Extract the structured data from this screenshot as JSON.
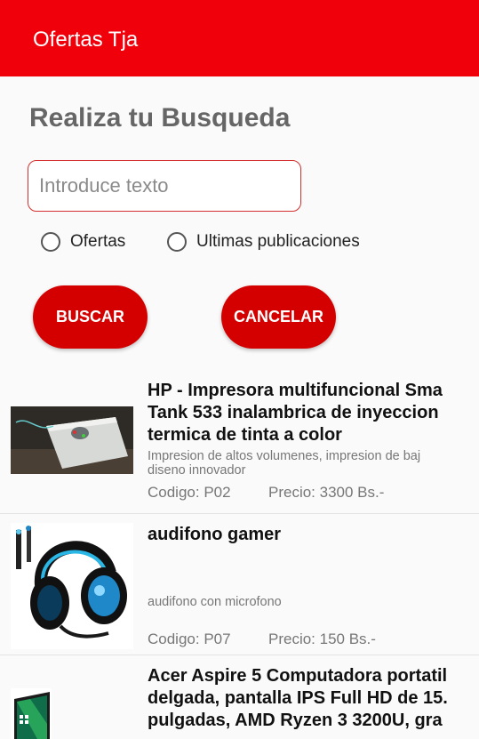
{
  "appbar": {
    "title": "Ofertas Tja"
  },
  "search": {
    "heading": "Realiza tu Busqueda",
    "placeholder": "Introduce texto",
    "value": "",
    "options": [
      {
        "label": "Ofertas",
        "selected": false
      },
      {
        "label": "Ultimas publicaciones",
        "selected": false
      }
    ],
    "buscar_label": "BUSCAR",
    "cancelar_label": "CANCELAR"
  },
  "products": [
    {
      "title_lines": [
        "HP - Impresora multifuncional Sma",
        "Tank 533 inalambrica de inyeccion",
        "termica de tinta a color"
      ],
      "desc_lines": [
        "Impresion de altos volumenes, impresion de baj",
        "diseno innovador"
      ],
      "code": "Codigo: P02",
      "price": "Precio: 3300 Bs.-"
    },
    {
      "title_lines": [
        "audifono gamer"
      ],
      "desc_lines": [
        "audifono con microfono"
      ],
      "code": "Codigo: P07",
      "price": "Precio: 150 Bs.-"
    },
    {
      "title_lines": [
        "Acer Aspire 5 Computadora portatil",
        "delgada, pantalla IPS Full HD de 15.",
        "pulgadas, AMD Ryzen 3 3200U, gra"
      ],
      "desc_lines": [],
      "code": "",
      "price": ""
    }
  ],
  "colors": {
    "appbar": "#f0000a",
    "button": "#d40000",
    "field_border": "#d32f2f"
  }
}
